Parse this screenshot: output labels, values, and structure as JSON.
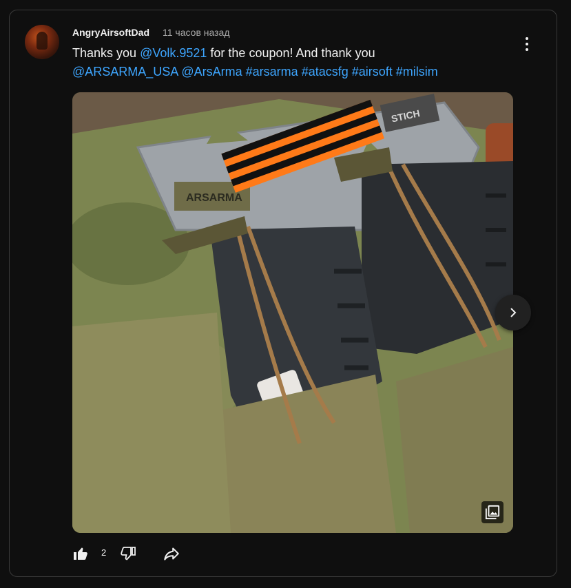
{
  "post": {
    "author": "AngryAirsoftDad",
    "time": "11 часов назад",
    "text_segments": [
      {
        "text": "Thanks you ",
        "link": false
      },
      {
        "text": "@Volk.9521",
        "link": true
      },
      {
        "text": " for the coupon! And thank you ",
        "link": false
      },
      {
        "text": "@ARSARMA_USA",
        "link": true
      },
      {
        "text": " ",
        "link": false
      },
      {
        "text": "@ArsArma",
        "link": true
      },
      {
        "text": " ",
        "link": false
      },
      {
        "text": "#arsarma",
        "link": true
      },
      {
        "text": " ",
        "link": false
      },
      {
        "text": "#atacsfg",
        "link": true
      },
      {
        "text": " ",
        "link": false
      },
      {
        "text": "#airsoft",
        "link": true
      },
      {
        "text": " ",
        "link": false
      },
      {
        "text": "#milsim",
        "link": true
      }
    ],
    "image_labels": {
      "brand_plate": "ARSARMA",
      "patch": "STICH"
    },
    "like_count": "2"
  },
  "icons": {
    "menu": "more-vert-icon",
    "next": "chevron-right-icon",
    "multi_image": "photo-library-icon",
    "like": "thumb-up-icon",
    "dislike": "thumb-down-icon",
    "share": "share-icon"
  },
  "colors": {
    "background": "#0f0f0f",
    "text": "#f1f1f1",
    "secondary": "#aaaaaa",
    "link": "#3ea6ff"
  }
}
